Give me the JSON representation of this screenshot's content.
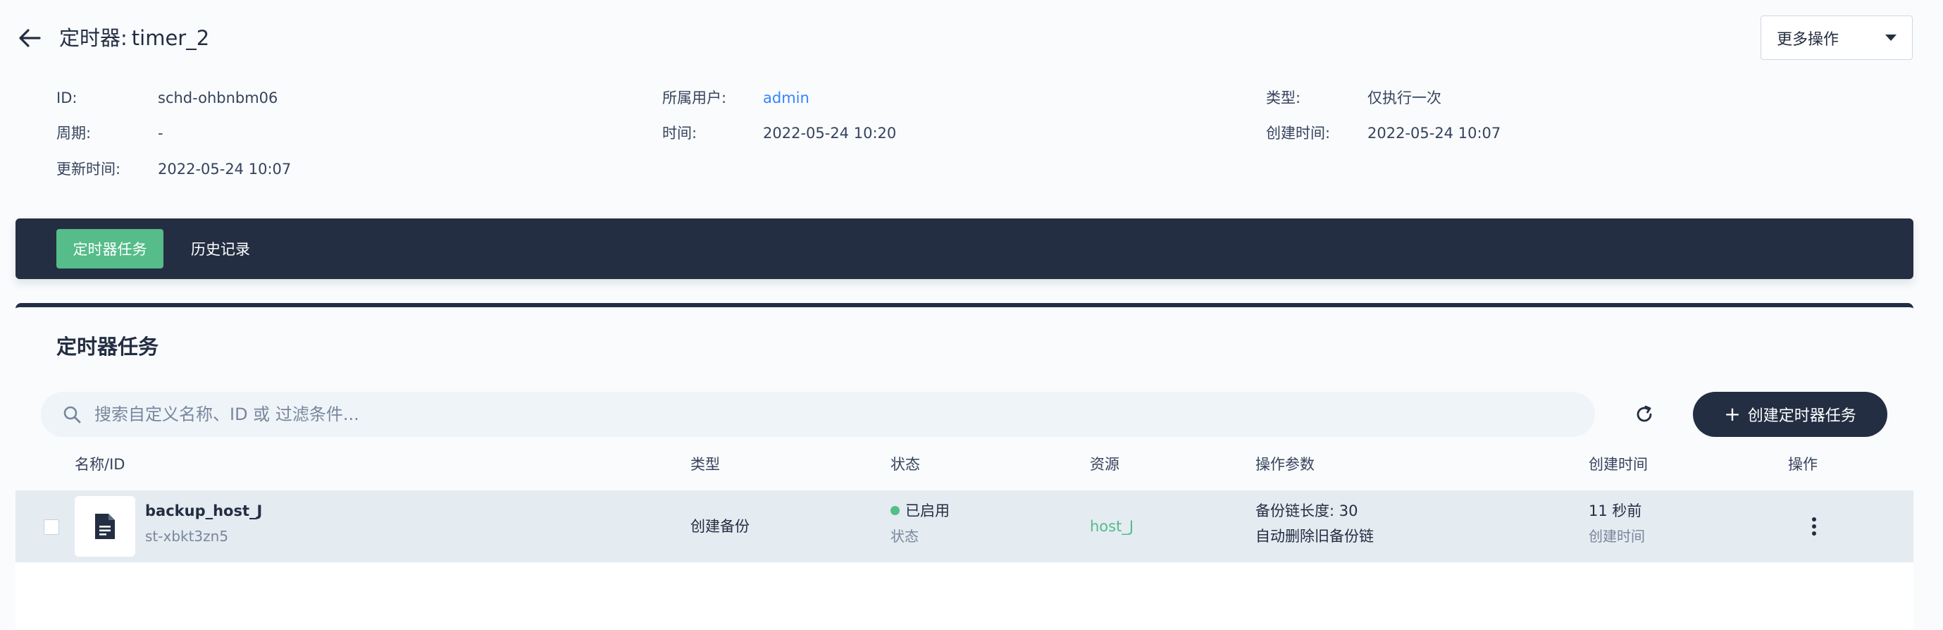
{
  "header": {
    "title_prefix": "定时器:",
    "title_name": "timer_2",
    "more_actions_label": "更多操作"
  },
  "info": {
    "id_label": "ID:",
    "id_value": "schd-ohbnbm06",
    "owner_label": "所属用户:",
    "owner_value": "admin",
    "type_label": "类型:",
    "type_value": "仅执行一次",
    "period_label": "周期:",
    "period_value": "-",
    "time_label": "时间:",
    "time_value": "2022-05-24 10:20",
    "created_label": "创建时间:",
    "created_value": "2022-05-24 10:07",
    "updated_label": "更新时间:",
    "updated_value": "2022-05-24 10:07"
  },
  "tabs": [
    {
      "label": "定时器任务",
      "active": true
    },
    {
      "label": "历史记录",
      "active": false
    }
  ],
  "card": {
    "title": "定时器任务",
    "search_placeholder": "搜索自定义名称、ID 或 过滤条件...",
    "create_label": "创建定时器任务"
  },
  "table": {
    "columns": [
      "名称/ID",
      "类型",
      "状态",
      "资源",
      "操作参数",
      "创建时间",
      "操作"
    ],
    "rows": [
      {
        "name": "backup_host_J",
        "id": "st-xbkt3zn5",
        "type": "创建备份",
        "status": "已启用",
        "status_sub": "状态",
        "resource": "host_J",
        "param_line1": "备份链长度: 30",
        "param_line2": "自动删除旧备份链",
        "created": "11 秒前",
        "created_sub": "创建时间"
      }
    ]
  },
  "colors": {
    "navy": "#242e42",
    "green": "#55bc8a",
    "link_blue": "#3385ff",
    "page_bg": "#f9fbfd"
  }
}
